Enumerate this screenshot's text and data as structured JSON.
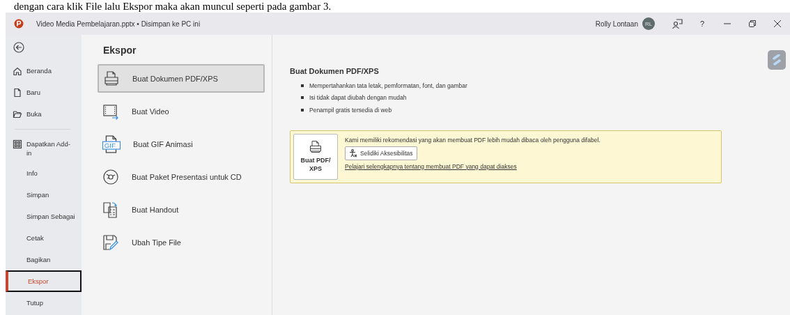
{
  "caption": "dengan cara klik File lalu Ekspor maka akan muncul seperti pada gambar 3.",
  "window": {
    "title": "Video Media Pembelajaran.pptx • Disimpan ke PC ini",
    "user": "Rolly Lontaan",
    "avatar": "RL",
    "help": "?"
  },
  "sidebar": {
    "groups": [
      [
        {
          "label": "Beranda",
          "selected": false
        },
        {
          "label": "Baru",
          "selected": false
        },
        {
          "label": "Buka",
          "selected": false
        }
      ],
      [
        {
          "label": "Dapatkan Add-in",
          "selected": false
        },
        {
          "label": "Info",
          "selected": false
        },
        {
          "label": "Simpan",
          "selected": false
        },
        {
          "label": "Simpan Sebagai",
          "selected": false
        },
        {
          "label": "Cetak",
          "selected": false
        },
        {
          "label": "Bagikan",
          "selected": false
        },
        {
          "label": "Ekspor",
          "selected": true
        },
        {
          "label": "Tutup",
          "selected": false
        }
      ]
    ]
  },
  "export": {
    "title": "Ekspor",
    "options": [
      {
        "label": "Buat Dokumen PDF/XPS",
        "selected": true
      },
      {
        "label": "Buat Video",
        "selected": false
      },
      {
        "label": "Buat GIF Animasi",
        "selected": false,
        "icon_text": "GIF"
      },
      {
        "label": "Buat Paket Presentasi untuk CD",
        "selected": false
      },
      {
        "label": "Buat Handout",
        "selected": false
      },
      {
        "label": "Ubah Tipe File",
        "selected": false
      }
    ],
    "detail": {
      "title": "Buat Dokumen PDF/XPS",
      "bullets": [
        "Mempertahankan tata letak, pemformatan, font, dan gambar",
        "Isi tidak dapat diubah dengan mudah",
        "Penampil gratis tersedia di web"
      ],
      "notice": {
        "button": "Buat PDF/ XPS",
        "message": "Kami memiliki rekomendasi yang akan membuat PDF lebih mudah dibaca oleh pengguna difabel.",
        "check_button": "Selidiki Aksesibilitas",
        "link": "Pelajari selengkapnya tentang membuat PDF yang dapat diakses"
      }
    }
  }
}
